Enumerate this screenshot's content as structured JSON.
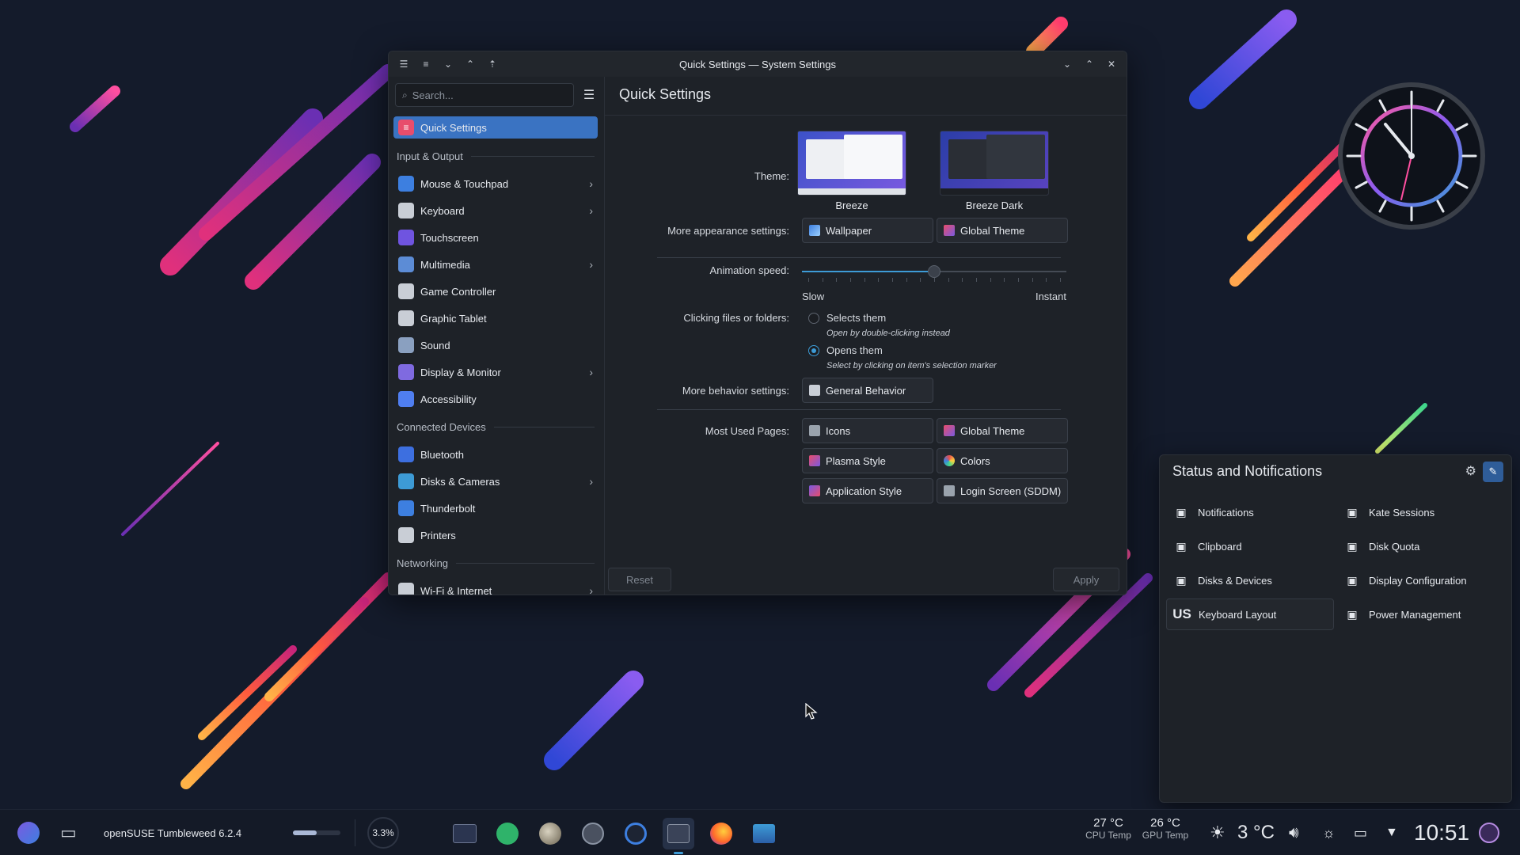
{
  "window": {
    "title": "Quick Settings — System Settings",
    "search_placeholder": "Search...",
    "page_title": "Quick Settings"
  },
  "sidebar": {
    "active": "Quick Settings",
    "categories": [
      {
        "label": "Input & Output",
        "items": [
          {
            "label": "Mouse & Touchpad",
            "icon": "mouse-icon",
            "color": "#3d7fe0",
            "submenu": true
          },
          {
            "label": "Keyboard",
            "icon": "keyboard-icon",
            "color": "#c9ced6",
            "submenu": true
          },
          {
            "label": "Touchscreen",
            "icon": "touchscreen-icon",
            "color": "#6f54e0",
            "submenu": false
          },
          {
            "label": "Multimedia",
            "icon": "multimedia-icon",
            "color": "#5c8cd6",
            "submenu": true
          },
          {
            "label": "Game Controller",
            "icon": "gamepad-icon",
            "color": "#c9ced6",
            "submenu": false
          },
          {
            "label": "Graphic Tablet",
            "icon": "tablet-icon",
            "color": "#c9ced6",
            "submenu": false
          },
          {
            "label": "Sound",
            "icon": "speaker-icon",
            "color": "#8aa0c0",
            "submenu": false
          },
          {
            "label": "Display & Monitor",
            "icon": "monitor-icon",
            "color": "#7f6ae0",
            "submenu": true
          },
          {
            "label": "Accessibility",
            "icon": "accessibility-icon",
            "color": "#4f7ef0",
            "submenu": false
          }
        ]
      },
      {
        "label": "Connected Devices",
        "items": [
          {
            "label": "Bluetooth",
            "icon": "bluetooth-icon",
            "color": "#3d6fe0",
            "submenu": false
          },
          {
            "label": "Disks & Cameras",
            "icon": "disk-icon",
            "color": "#3d9bd6",
            "submenu": true
          },
          {
            "label": "Thunderbolt",
            "icon": "thunderbolt-icon",
            "color": "#3d7fe0",
            "submenu": false
          },
          {
            "label": "Printers",
            "icon": "printer-icon",
            "color": "#c9ced6",
            "submenu": false
          }
        ]
      },
      {
        "label": "Networking",
        "items": [
          {
            "label": "Wi-Fi & Internet",
            "icon": "network-icon",
            "color": "#c9ced6",
            "submenu": true
          }
        ]
      }
    ]
  },
  "quick_settings": {
    "theme_label": "Theme:",
    "themes": [
      "Breeze",
      "Breeze Dark"
    ],
    "appearance_label": "More appearance settings:",
    "appearance_buttons": [
      "Wallpaper",
      "Global Theme"
    ],
    "animation_label": "Animation speed:",
    "animation_value": 0.5,
    "slow_label": "Slow",
    "instant_label": "Instant",
    "clicking_label": "Clicking files or folders:",
    "clicking_options": [
      {
        "label": "Selects them",
        "hint": "Open by double-clicking instead",
        "checked": false
      },
      {
        "label": "Opens them",
        "hint": "Select by clicking on item's selection marker",
        "checked": true
      }
    ],
    "behavior_label": "More behavior settings:",
    "behavior_button": "General Behavior",
    "most_used_label": "Most Used Pages:",
    "most_used": [
      "Icons",
      "Global Theme",
      "Plasma Style",
      "Colors",
      "Application Style",
      "Login Screen (SDDM)"
    ],
    "reset": "Reset",
    "apply": "Apply"
  },
  "status_popup": {
    "title": "Status and Notifications",
    "items": [
      {
        "label": "Notifications",
        "icon": "notifications-icon"
      },
      {
        "label": "Kate Sessions",
        "icon": "kate-icon"
      },
      {
        "label": "Clipboard",
        "icon": "clipboard-icon"
      },
      {
        "label": "Disk Quota",
        "icon": "disk-quota-icon"
      },
      {
        "label": "Disks & Devices",
        "icon": "usb-icon"
      },
      {
        "label": "Display Configuration",
        "icon": "display-config-icon"
      },
      {
        "label": "Keyboard Layout",
        "icon": "keyboard-layout-icon",
        "badge": "US"
      },
      {
        "label": "Power Management",
        "icon": "power-icon"
      }
    ]
  },
  "taskbar": {
    "distro": "openSUSE Tumbleweed 6.2.4",
    "cpu_usage": "3.3%",
    "memory_fraction": 0.5,
    "cpu_temp": "27 °C",
    "cpu_temp_label": "CPU Temp",
    "gpu_temp": "26 °C",
    "gpu_temp_label": "GPU Temp",
    "weather": "3 °C",
    "clock": "10:51"
  }
}
